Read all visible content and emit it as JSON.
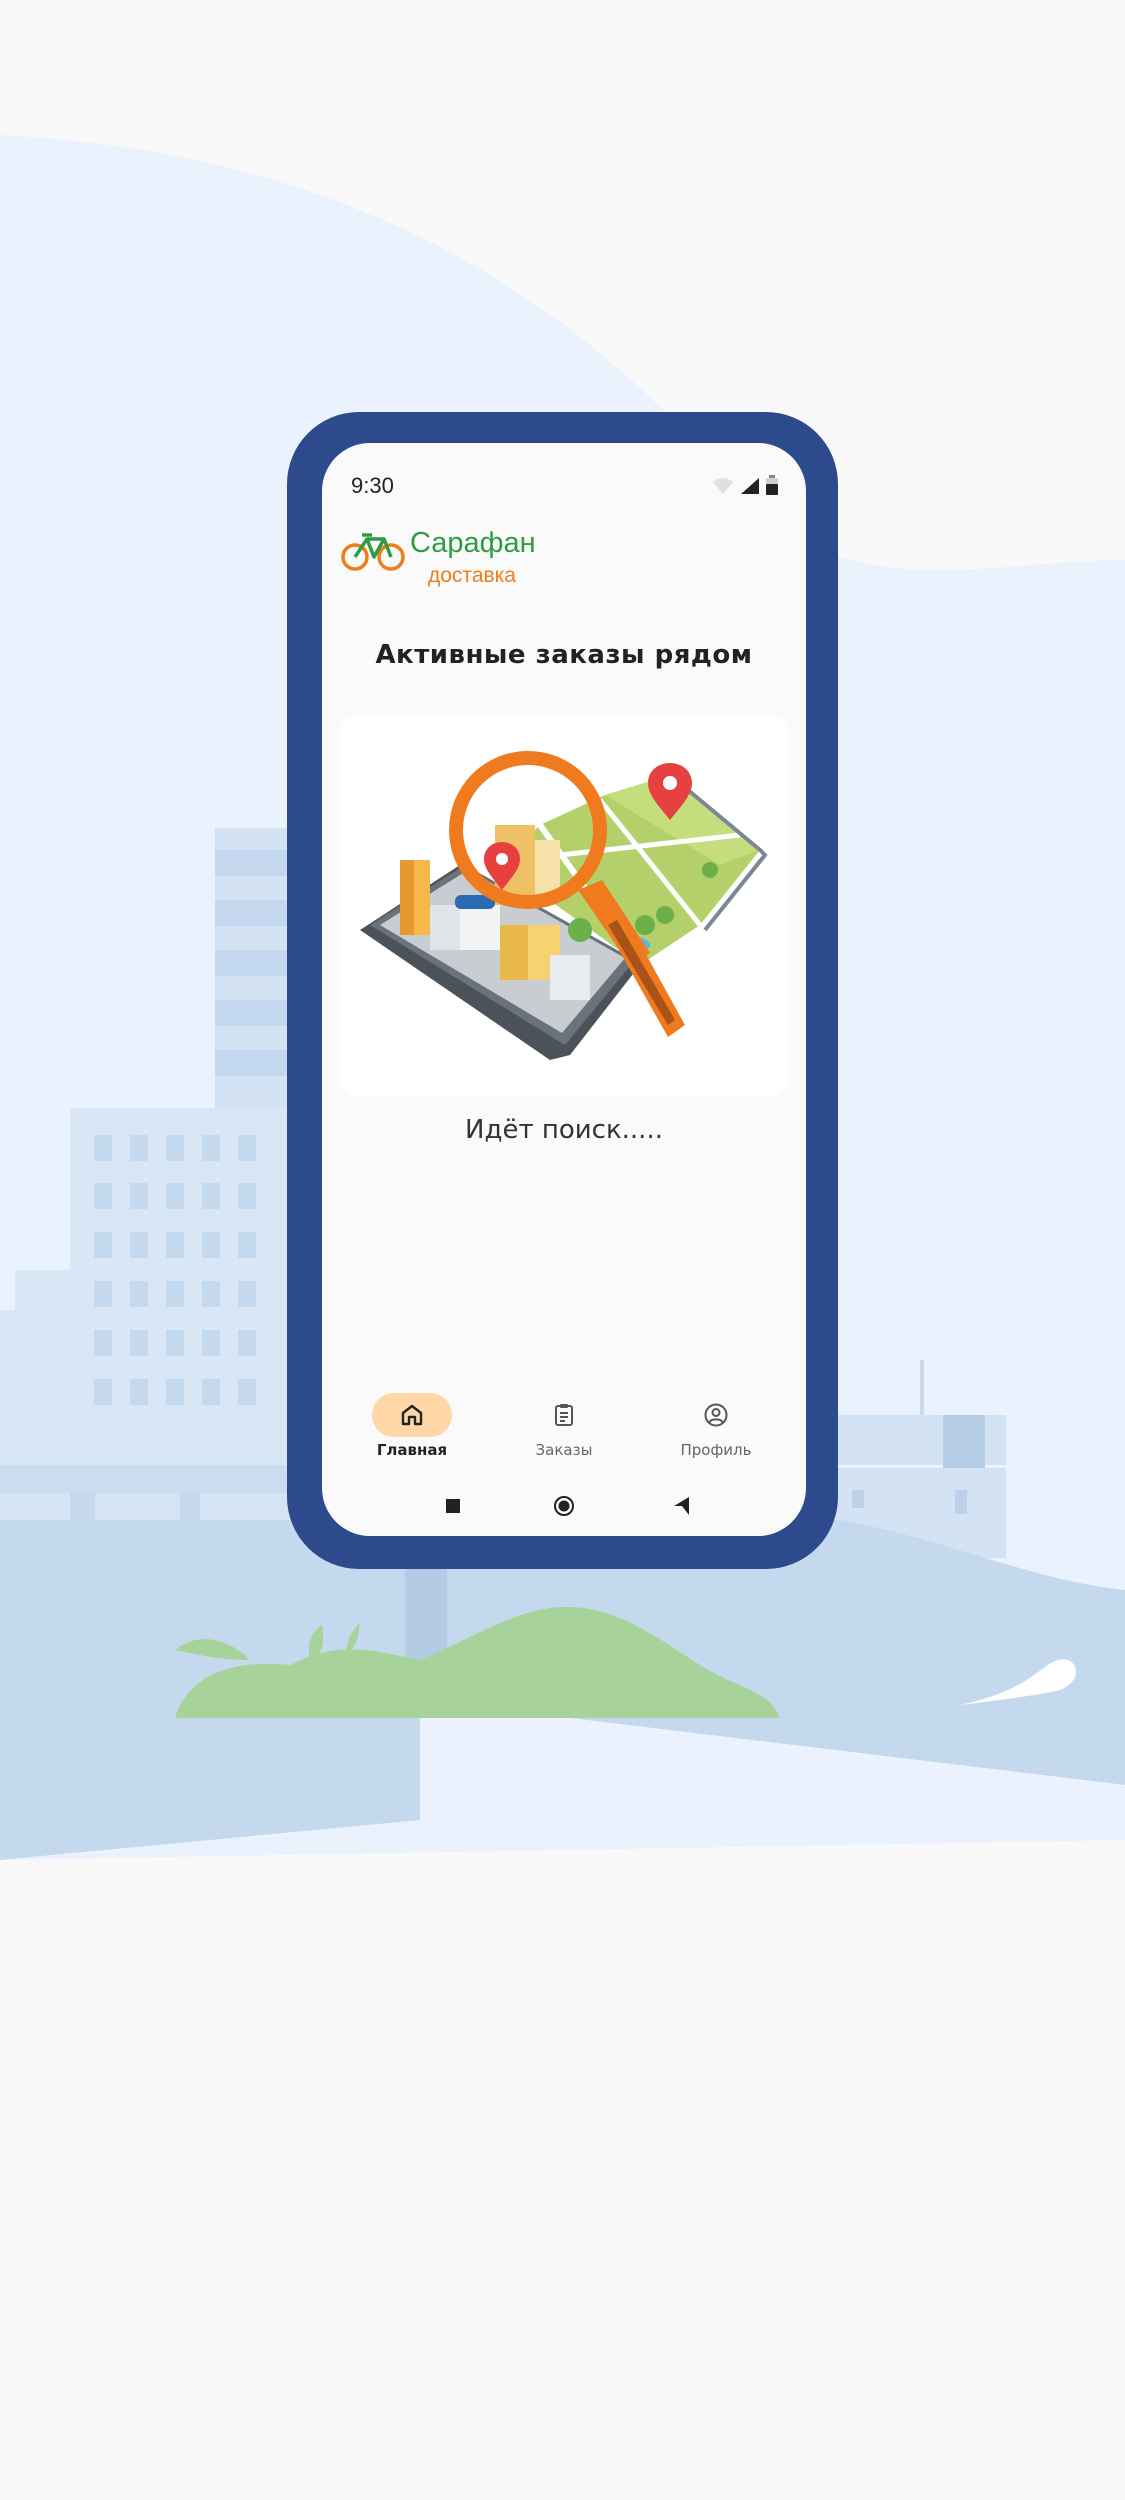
{
  "status_bar": {
    "time": "9:30"
  },
  "logo": {
    "line1": "Сарафан",
    "line2": "доставка"
  },
  "main": {
    "title": "Активные заказы рядом",
    "status": "Идёт поиск....."
  },
  "nav": {
    "items": [
      {
        "label": "Главная",
        "icon": "home-icon",
        "active": true
      },
      {
        "label": "Заказы",
        "icon": "clipboard-icon",
        "active": false
      },
      {
        "label": "Профиль",
        "icon": "profile-icon",
        "active": false
      }
    ]
  },
  "colors": {
    "frame": "#2d4a8d",
    "brand_green": "#2e9c44",
    "brand_orange": "#ef7d1a",
    "nav_active": "#ffd7a6"
  }
}
